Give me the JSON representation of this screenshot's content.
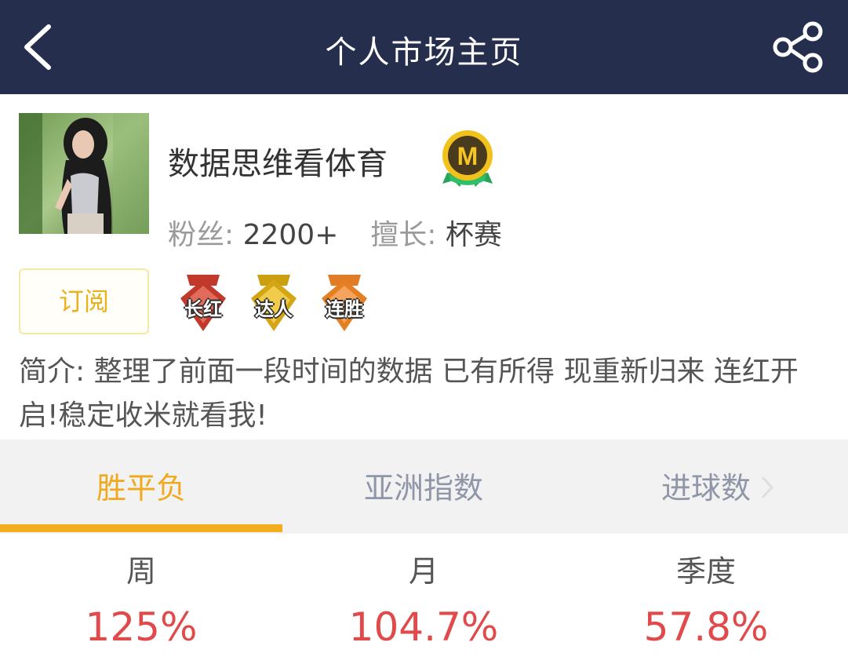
{
  "header": {
    "title": "个人市场主页",
    "back_icon": "chevron-left-icon",
    "share_icon": "share-icon"
  },
  "profile": {
    "name": "数据思维看体育",
    "fans_label": "粉丝:",
    "fans_value": "2200+",
    "specialty_label": "擅长:",
    "specialty_value": "杯赛",
    "badge_letter": "M",
    "subscribe_label": "订阅",
    "medals": [
      {
        "label": "长红",
        "color": "#c0392b"
      },
      {
        "label": "达人",
        "color": "#d4a514"
      },
      {
        "label": "连胜",
        "color": "#e67e22"
      }
    ],
    "intro": "简介:  整理了前面一段时间的数据  已有所得  现重新归来 连红开启!稳定收米就看我!"
  },
  "tabs": [
    {
      "label": "胜平负",
      "active": true
    },
    {
      "label": "亚洲指数",
      "active": false
    },
    {
      "label": "进球数",
      "active": false
    }
  ],
  "periods": [
    {
      "label": "周",
      "value": "125%"
    },
    {
      "label": "月",
      "value": "104.7%"
    },
    {
      "label": "季度",
      "value": "57.8%"
    }
  ],
  "colors": {
    "header_bg": "#262e4e",
    "accent": "#f0a91d",
    "positive": "#e04a4a"
  }
}
